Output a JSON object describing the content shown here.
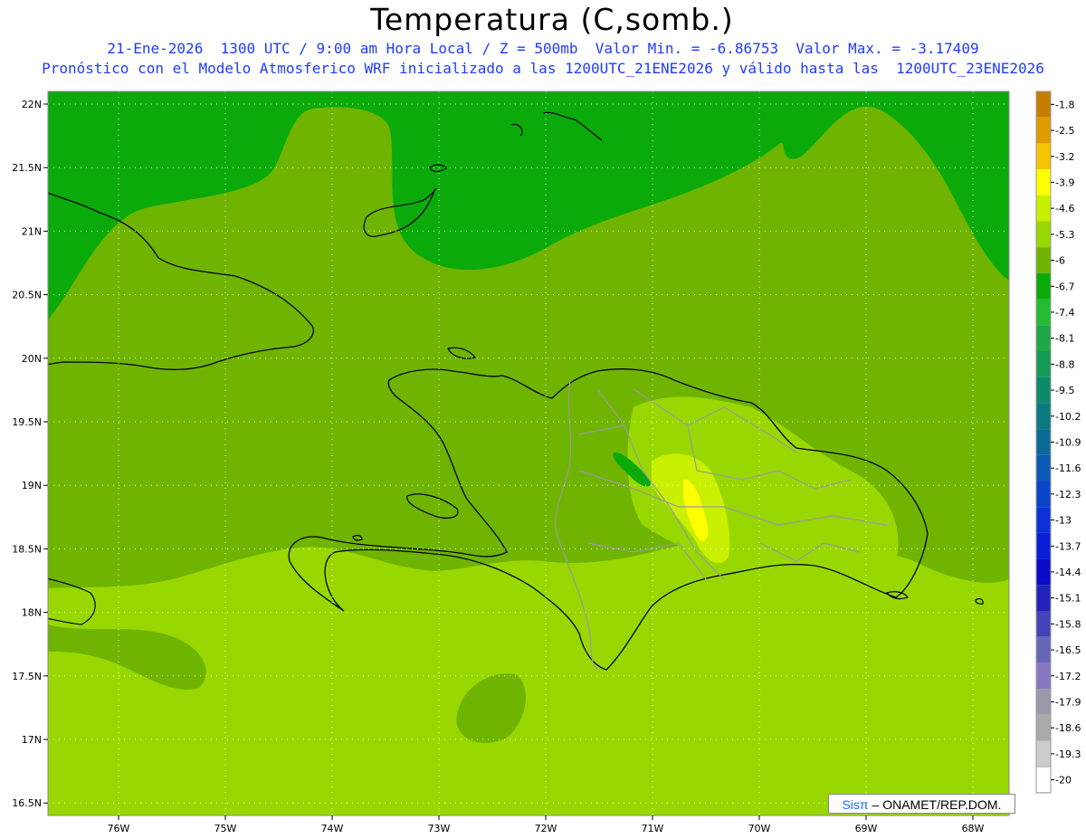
{
  "title": "Temperatura (C,somb.)",
  "subtitle_1": "21-Ene-2026  1300 UTC / 9:00 am Hora Local / Z = 500mb  Valor Min. = -6.86753  Valor Max. = -3.17409",
  "subtitle_2": "Pronóstico con el Modelo Atmosferico WRF inicializado a las 1200UTC_21ENE2026 y válido hasta las  1200UTC_23ENE2026",
  "credit": {
    "brand": "Sisπ",
    "text": " – ONAMET/REP.DOM."
  },
  "chart_data": {
    "type": "heatmap",
    "variable": "Temperatura (C,somb.)",
    "level": "500mb",
    "min_value": -6.86753,
    "max_value": -3.17409,
    "lat_ticks": [
      "22N",
      "21.5N",
      "21N",
      "20.5N",
      "20N",
      "19.5N",
      "19N",
      "18.5N",
      "18N",
      "17.5N",
      "17N",
      "16.5N"
    ],
    "lon_ticks": [
      "76W",
      "75W",
      "74W",
      "73W",
      "72W",
      "71W",
      "70W",
      "69W",
      "68W"
    ],
    "legend": {
      "levels": [
        "-1.8",
        "-2.5",
        "-3.2",
        "-3.9",
        "-4.6",
        "-5.3",
        "-6",
        "-6.7",
        "-7.4",
        "-8.1",
        "-8.8",
        "-9.5",
        "-10.2",
        "-10.9",
        "-11.6",
        "-12.3",
        "-13",
        "-13.7",
        "-14.4",
        "-15.1",
        "-15.8",
        "-16.5",
        "-17.2",
        "-17.9",
        "-18.6",
        "-19.3",
        "-20"
      ],
      "colors": [
        "#c47d00",
        "#e09a00",
        "#f5c400",
        "#ffff00",
        "#c8f000",
        "#98d800",
        "#6fb400",
        "#0aaa0a",
        "#22bb33",
        "#1ea845",
        "#139a55",
        "#0c8a6a",
        "#0a7a80",
        "#0a6a9a",
        "#0a5ab4",
        "#0a44c8",
        "#0a30d8",
        "#0a1ed4",
        "#0a0ac8",
        "#2222bb",
        "#4444b8",
        "#6666b8",
        "#8877c0",
        "#9999aa",
        "#aaaaaa",
        "#cccccc",
        "#ffffff"
      ]
    },
    "field_colors": {
      "cold_ring": "#0aaa0a",
      "main": "#6fb400",
      "light": "#98d800",
      "lighter": "#c8f000",
      "warm_core": "#ffff00"
    },
    "grid": true
  }
}
